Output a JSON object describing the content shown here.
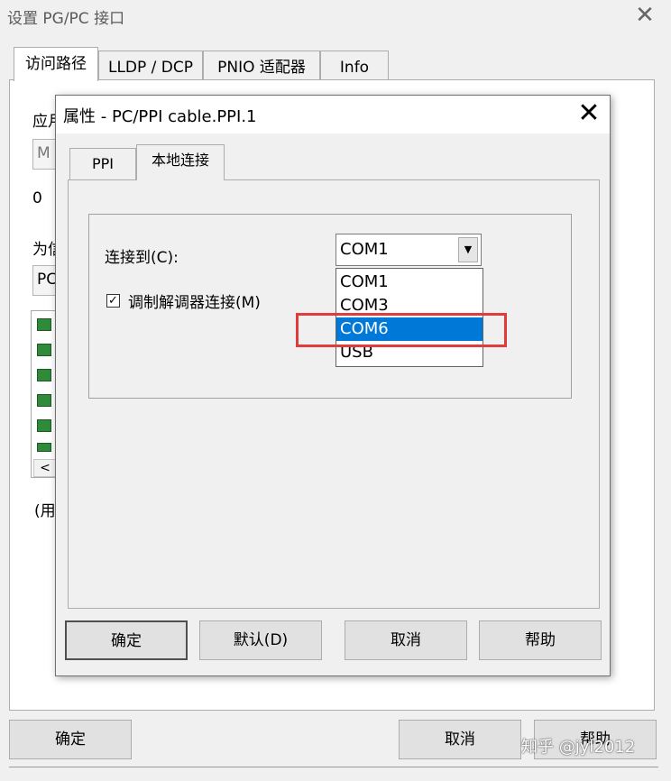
{
  "outer": {
    "title": "设置 PG/PC 接口",
    "tabs": [
      "访问路径",
      "LLDP / DCP",
      "PNIO 适配器",
      "Info"
    ],
    "frag_app": "应月",
    "field1": "M",
    "frag_zero": "0",
    "frag_for": "为信",
    "field2": "PC",
    "frag_use": "(用",
    "buttons": {
      "ok": "确定",
      "cancel": "取消",
      "help": "帮助"
    }
  },
  "dialog": {
    "title": "属性 - PC/PPI cable.PPI.1",
    "tabs": [
      "PPI",
      "本地连接"
    ],
    "connect_label": "连接到(C):",
    "modem_label": "调制解调器连接(M)",
    "modem_checked": true,
    "combo_value": "COM1",
    "options": [
      "COM1",
      "COM3",
      "COM6",
      "USB"
    ],
    "selected_option": "COM6",
    "buttons": {
      "ok": "确定",
      "default": "默认(D)",
      "cancel": "取消",
      "help": "帮助"
    }
  },
  "watermark": "知乎 @jyl2012",
  "colors": {
    "selection": "#0078d7",
    "annotation": "#e03c3c"
  }
}
